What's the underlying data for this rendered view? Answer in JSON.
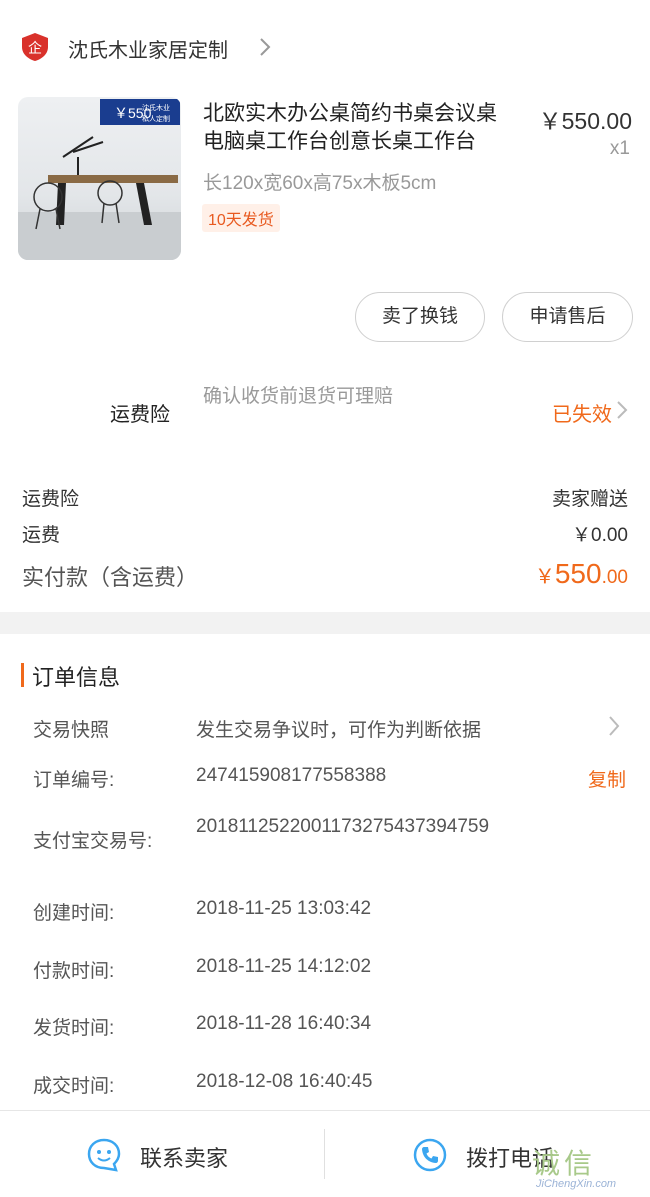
{
  "shop": {
    "name": "沈氏木业家居定制",
    "logo_text": "企"
  },
  "product": {
    "title": "北欧实木办公桌简约书桌会议桌电脑桌工作台创意长桌工作台",
    "price": "￥550.00",
    "quantity": "x1",
    "spec": "长120x宽60x高75x木板5cm",
    "ship_tag": "10天发货",
    "image_badge_price": "￥550",
    "image_badge_line1": "沈氏木业",
    "image_badge_line2": "私人定制"
  },
  "actions": {
    "resell": "卖了换钱",
    "aftersale": "申请售后"
  },
  "insurance": {
    "label": "运费险",
    "desc": "确认收货前退货可理赔",
    "status": "已失效"
  },
  "fees": {
    "insurance_label": "运费险",
    "insurance_value": "卖家赠送",
    "shipping_label": "运费",
    "shipping_value": "￥0.00",
    "total_label": "实付款（含运费）",
    "total_currency": "￥",
    "total_integer": "550",
    "total_decimal": ".00"
  },
  "order_info": {
    "title": "订单信息",
    "snapshot_label": "交易快照",
    "snapshot_value": "发生交易争议时，可作为判断依据",
    "order_no_label": "订单编号:",
    "order_no_value": "247415908177558388",
    "copy_label": "复制",
    "alipay_label": "支付宝交易号:",
    "alipay_value": "2018112522001173275437394759",
    "created_label": "创建时间:",
    "created_value": "2018-11-25 13:03:42",
    "paid_label": "付款时间:",
    "paid_value": "2018-11-25 14:12:02",
    "shipped_label": "发货时间:",
    "shipped_value": "2018-11-28 16:40:34",
    "closed_label": "成交时间:",
    "closed_value": "2018-12-08 16:40:45"
  },
  "bottom_bar": {
    "contact_seller": "联系卖家",
    "call_phone": "拨打电话"
  },
  "watermark": {
    "main": "诚信",
    "sub": "JiChengXin.com"
  },
  "colors": {
    "accent": "#f0691b",
    "icon_blue": "#3ba6f0",
    "shop_logo_red": "#d9312b"
  }
}
